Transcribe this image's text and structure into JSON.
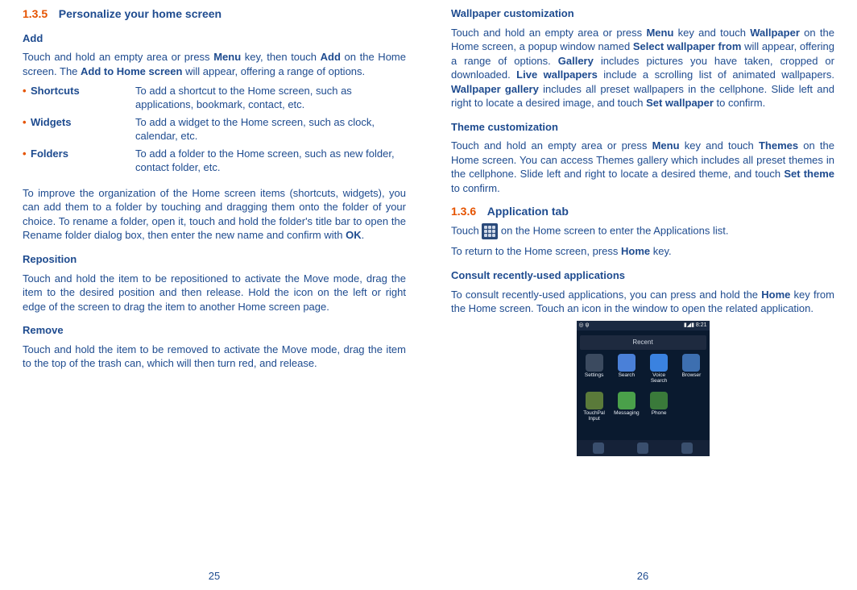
{
  "left": {
    "sectionNum": "1.3.5",
    "sectionTitle": "Personalize your home screen",
    "addHead": "Add",
    "addPara_a": "Touch and hold an empty area or press ",
    "addPara_b": "Menu",
    "addPara_c": " key, then touch ",
    "addPara_d": "Add",
    "addPara_e": " on the Home screen. The ",
    "addPara_f": "Add to Home screen",
    "addPara_g": " will appear, offering a range of options.",
    "bullets": [
      {
        "label": "Shortcuts",
        "desc": "To add a shortcut to the Home screen, such as applications, bookmark, contact, etc."
      },
      {
        "label": "Widgets",
        "desc": "To add a widget to the Home screen, such as clock, calendar, etc."
      },
      {
        "label": "Folders",
        "desc": "To add a folder to the Home screen, such as new folder, contact folder, etc."
      }
    ],
    "orgPara_a": "To improve the organization of the Home screen items (shortcuts, widgets), you can add them to a folder by touching and dragging them onto the folder of your choice. To rename a folder, open it, touch and hold the folder's title bar to open the Rename folder dialog box, then enter the new name and confirm with ",
    "orgPara_b": "OK",
    "orgPara_c": ".",
    "repoHead": "Reposition",
    "repoPara": "Touch and hold the item to be repositioned to activate the Move mode, drag the item to the desired position and then release. Hold the icon on the left or right edge of the screen to drag the item to another Home screen page.",
    "removeHead": "Remove",
    "removePara": "Touch and hold the item to be removed to activate the Move mode, drag the item to the top of the trash can, which will then turn red, and release.",
    "pageNum": "25"
  },
  "right": {
    "wallHead": "Wallpaper customization",
    "wallPara_a": "Touch and hold an empty area or press ",
    "wallPara_b": "Menu",
    "wallPara_c": " key and touch ",
    "wallPara_d": "Wallpaper",
    "wallPara_e": " on the Home screen, a popup window named ",
    "wallPara_f": "Select wallpaper from",
    "wallPara_g": " will appear, offering a range of options. ",
    "wallPara_h": "Gallery",
    "wallPara_i": " includes pictures you have taken, cropped or downloaded. ",
    "wallPara_j": "Live wallpapers",
    "wallPara_k": " include a scrolling list of animated wallpapers. ",
    "wallPara_l": "Wallpaper gallery",
    "wallPara_m": " includes all preset wallpapers in the cellphone. Slide left and right to locate a desired image, and touch ",
    "wallPara_n": "Set wallpaper",
    "wallPara_o": " to confirm.",
    "themeHead": "Theme customization",
    "themePara_a": "Touch and hold an empty area or press ",
    "themePara_b": "Menu",
    "themePara_c": " key and touch ",
    "themePara_d": "Themes",
    "themePara_e": " on the Home screen. You can access Themes gallery which includes all preset themes in the cellphone. Slide left and right to locate a desired theme, and touch ",
    "themePara_f": "Set theme",
    "themePara_g": " to confirm.",
    "sectionNum": "1.3.6",
    "sectionTitle": "Application tab",
    "appPara_a": "Touch ",
    "appPara_b": " on the Home screen to enter the Applications list.",
    "returnPara_a": "To return to the Home screen, press ",
    "returnPara_b": "Home",
    "returnPara_c": " key.",
    "consultHead": "Consult recently-used applications",
    "consultPara_a": "To consult recently-used applications, you can press and hold the ",
    "consultPara_b": "Home",
    "consultPara_c": " key from the Home screen. Touch an icon in the window to open the related application.",
    "pageNum": "26",
    "screenshot": {
      "time": "8:21",
      "recent": "Recent",
      "apps": [
        {
          "label": "Settings",
          "color": "#3b4a5f"
        },
        {
          "label": "Search",
          "color": "#4a80d8"
        },
        {
          "label": "Voice Search",
          "color": "#3a82e0"
        },
        {
          "label": "Browser",
          "color": "#3d6fb0"
        },
        {
          "label": "TouchPal Input",
          "color": "#5a7a3a"
        },
        {
          "label": "Messaging",
          "color": "#4aa04a"
        },
        {
          "label": "Phone",
          "color": "#3a7a3a"
        }
      ]
    }
  }
}
